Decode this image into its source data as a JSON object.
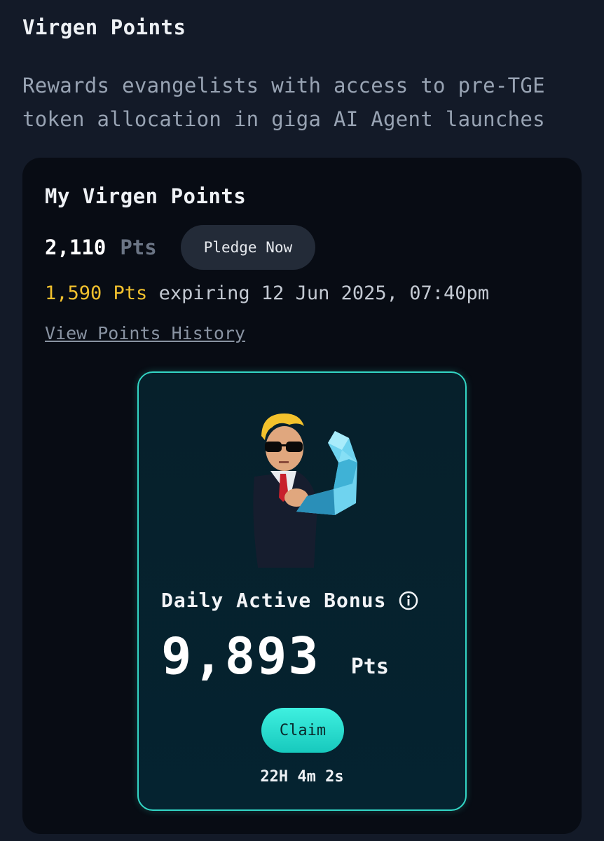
{
  "section": {
    "title": "Virgen Points",
    "description": "Rewards evangelists with access to pre-TGE token allocation in giga AI Agent launches"
  },
  "card": {
    "title": "My Virgen Points",
    "points_value": "2,110",
    "points_unit": "Pts",
    "pledge_label": "Pledge Now",
    "expiring_amount": "1,590 Pts",
    "expiring_text": "expiring 12 Jun 2025, 07:40pm",
    "history_link": "View Points History"
  },
  "bonus": {
    "label": "Daily Active Bonus",
    "info_icon": "info-icon",
    "value": "9,893",
    "unit": "Pts",
    "claim_label": "Claim",
    "countdown": "22H 4m 2s"
  },
  "colors": {
    "page_bg": "#131a28",
    "card_bg": "#080c14",
    "accent_teal": "#33d6c5",
    "expiry_yellow": "#f2c12e"
  }
}
